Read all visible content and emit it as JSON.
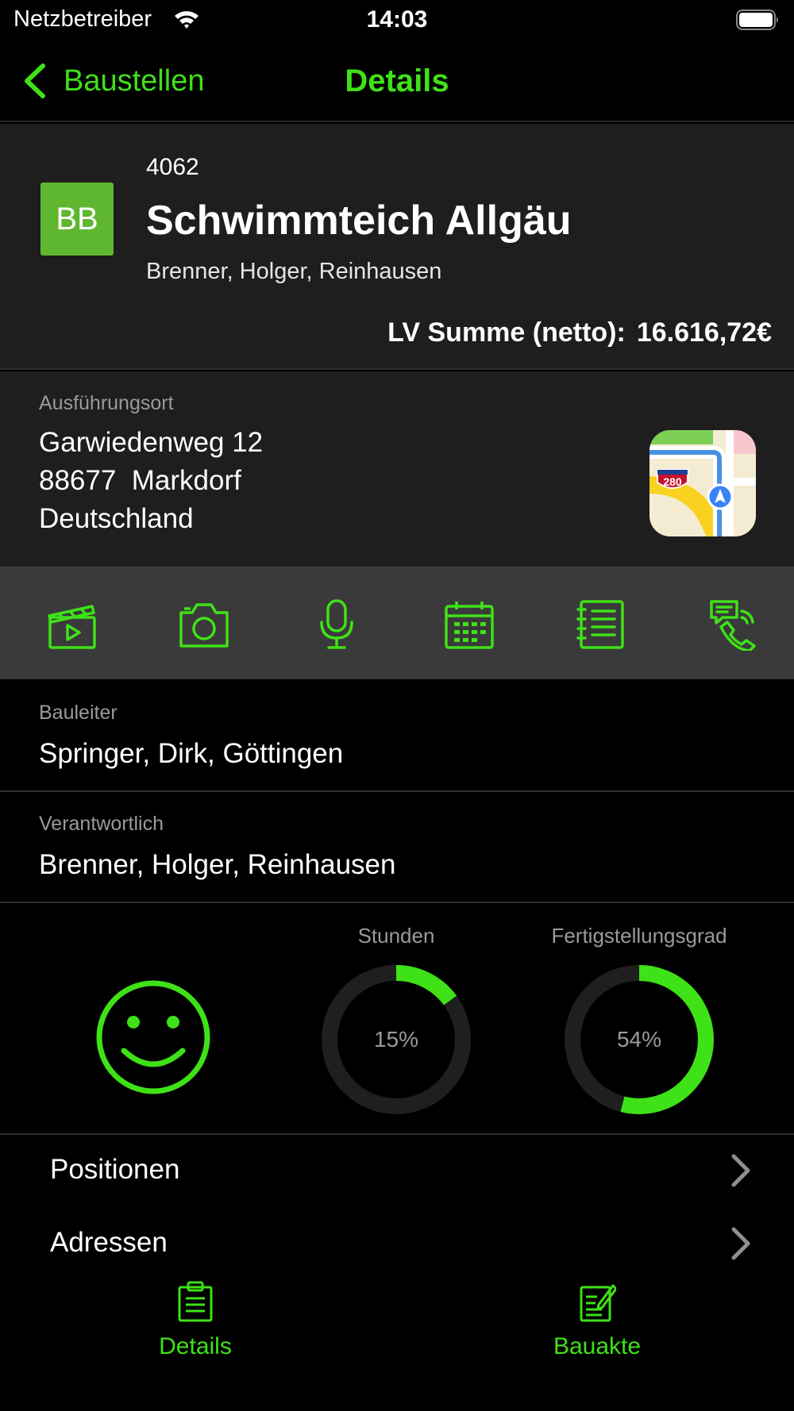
{
  "status_bar": {
    "carrier": "Netzbetreiber",
    "time": "14:03"
  },
  "nav": {
    "back_label": "Baustellen",
    "title": "Details"
  },
  "project": {
    "initials": "BB",
    "number": "4062",
    "title": "Schwimmteich Allgäu",
    "client": "Brenner, Holger, Reinhausen",
    "lv_label": "LV Summe (netto):",
    "lv_value": "16.616,72€"
  },
  "location": {
    "label": "Ausführungsort",
    "street": "Garwiedenweg 12",
    "city": "88677  Markdorf",
    "country": "Deutschland",
    "map_shield": "280"
  },
  "toolbar": {
    "icons": [
      "video-icon",
      "camera-icon",
      "microphone-icon",
      "calendar-icon",
      "notes-icon",
      "contact-call-icon"
    ]
  },
  "bauleiter": {
    "label": "Bauleiter",
    "value": "Springer, Dirk, Göttingen"
  },
  "verantwortlich": {
    "label": "Verantwortlich",
    "value": "Brenner, Holger, Reinhausen"
  },
  "stats": {
    "mood_icon": "smiley-icon",
    "hours": {
      "label": "Stunden",
      "percent": 15,
      "text": "15%"
    },
    "completion": {
      "label": "Fertigstellungsgrad",
      "percent": 54,
      "text": "54%"
    }
  },
  "list": {
    "positionen": "Positionen",
    "adressen": "Adressen"
  },
  "tabs": {
    "details": "Details",
    "bauakte": "Bauakte"
  },
  "colors": {
    "accent": "#3fe117",
    "badge": "#5fb72f",
    "card": "#1e1e1e",
    "toolbar": "#3a3a3a",
    "gauge_track": "#1f1f1f"
  }
}
